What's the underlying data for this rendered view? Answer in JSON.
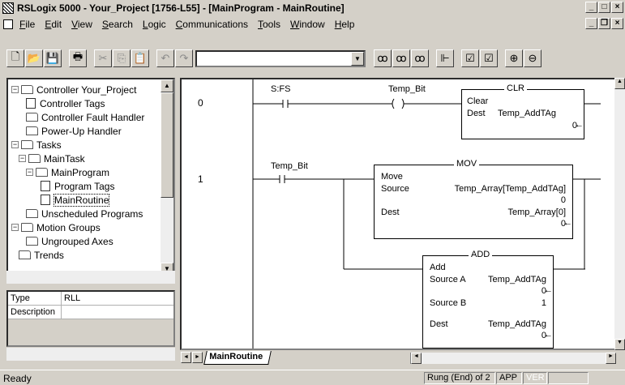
{
  "window": {
    "title": "RSLogix 5000 - Your_Project [1756-L55] - [MainProgram - MainRoutine]"
  },
  "menu": [
    "File",
    "Edit",
    "View",
    "Search",
    "Logic",
    "Communications",
    "Tools",
    "Window",
    "Help"
  ],
  "tree": [
    {
      "label": "Controller Your_Project",
      "indent": 0,
      "exp": "−",
      "icon": "folder"
    },
    {
      "label": "Controller Tags",
      "indent": 2,
      "exp": "",
      "icon": "doc"
    },
    {
      "label": "Controller Fault Handler",
      "indent": 2,
      "exp": "",
      "icon": "folder"
    },
    {
      "label": "Power-Up Handler",
      "indent": 2,
      "exp": "",
      "icon": "folder"
    },
    {
      "label": "Tasks",
      "indent": 0,
      "exp": "−",
      "icon": "folder"
    },
    {
      "label": "MainTask",
      "indent": 1,
      "exp": "−",
      "icon": "folder"
    },
    {
      "label": "MainProgram",
      "indent": 2,
      "exp": "−",
      "icon": "folder"
    },
    {
      "label": "Program Tags",
      "indent": 4,
      "exp": "",
      "icon": "doc"
    },
    {
      "label": "MainRoutine",
      "indent": 4,
      "exp": "",
      "icon": "doc",
      "selected": true
    },
    {
      "label": "Unscheduled Programs",
      "indent": 2,
      "exp": "",
      "icon": "folder"
    },
    {
      "label": "Motion Groups",
      "indent": 0,
      "exp": "−",
      "icon": "folder"
    },
    {
      "label": "Ungrouped Axes",
      "indent": 2,
      "exp": "",
      "icon": "folder"
    },
    {
      "label": "Trends",
      "indent": 1,
      "exp": "",
      "icon": "folder"
    }
  ],
  "props": [
    {
      "k": "Type",
      "v": "RLL"
    },
    {
      "k": "Description",
      "v": ""
    }
  ],
  "ladder": {
    "rung0": {
      "num": "0",
      "xic_tag": "S:FS",
      "ote_tag": "Temp_Bit",
      "clr": {
        "name": "CLR",
        "l1": "Clear",
        "dest_label": "Dest",
        "dest_tag": "Temp_AddTAg",
        "dest_val": "0"
      }
    },
    "rung1": {
      "num": "1",
      "xic_tag": "Temp_Bit",
      "mov": {
        "name": "MOV",
        "l1": "Move",
        "src_label": "Source",
        "src_tag": "Temp_Array[Temp_AddTAg]",
        "src_val": "0",
        "dest_label": "Dest",
        "dest_tag": "Temp_Array[0]",
        "dest_val": "0"
      },
      "add": {
        "name": "ADD",
        "l1": "Add",
        "a_label": "Source A",
        "a_tag": "Temp_AddTAg",
        "a_val": "0",
        "b_label": "Source B",
        "b_val": "1",
        "dest_label": "Dest",
        "dest_tag": "Temp_AddTAg",
        "dest_val": "0"
      }
    }
  },
  "tab_label": "MainRoutine",
  "status": {
    "ready": "Ready",
    "rung": "Rung (End) of 2",
    "app": "APP",
    "ver": "VER"
  }
}
